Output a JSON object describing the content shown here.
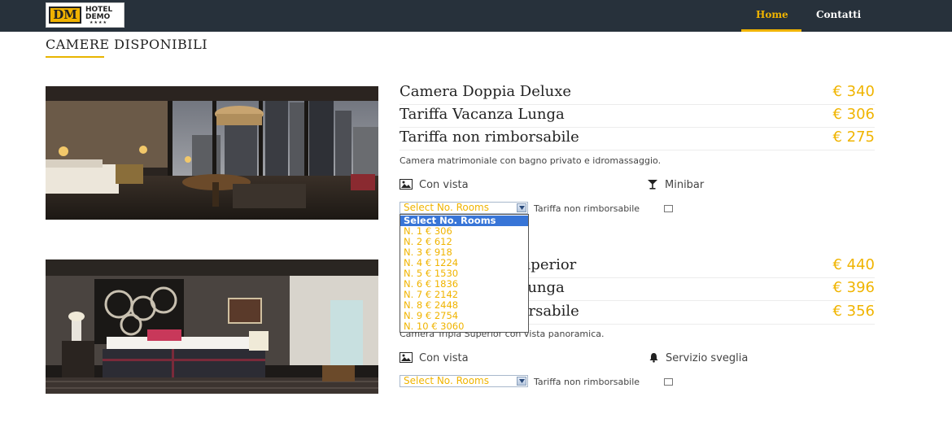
{
  "header": {
    "logo_mark": "DM",
    "logo_line1": "HOTEL",
    "logo_line2": "DEMO",
    "logo_stars": "★★★★",
    "nav": [
      {
        "label": "Home",
        "active": true
      },
      {
        "label": "Contatti",
        "active": false
      }
    ]
  },
  "section": {
    "title": "CAMERE DISPONIBILI"
  },
  "rooms": [
    {
      "rates": [
        {
          "name": "Camera Doppia Deluxe",
          "price": "€ 340"
        },
        {
          "name": "Tariffa Vacanza Lunga",
          "price": "€ 306"
        },
        {
          "name": "Tariffa non rimborsabile",
          "price": "€ 275"
        }
      ],
      "description": "Camera matrimoniale con bagno privato e idromassaggio.",
      "features": [
        {
          "icon": "picture-icon",
          "label": "Con vista"
        },
        {
          "icon": "cocktail-icon",
          "label": "Minibar"
        }
      ],
      "select_value": "Select No. Rooms",
      "refund_label": "Tariffa non rimborsabile"
    },
    {
      "rates": [
        {
          "name": "Camera Tripla Superior",
          "price": "€ 440"
        },
        {
          "name": "Tariffa Vacanza Lunga",
          "price": "€ 396"
        },
        {
          "name": "Tariffa non rimborsabile",
          "price": "€ 356"
        }
      ],
      "description": "Camera Tripla Superior con vista panoramica.",
      "features": [
        {
          "icon": "picture-icon",
          "label": "Con vista"
        },
        {
          "icon": "bell-icon",
          "label": "Servizio sveglia"
        }
      ],
      "select_value": "Select No. Rooms",
      "refund_label": "Tariffa non rimborsabile"
    }
  ],
  "dropdown": {
    "options": [
      "Select No. Rooms",
      "N. 1 € 306",
      "N. 2 € 612",
      "N. 3 € 918",
      "N. 4 € 1224",
      "N. 5 € 1530",
      "N. 6 € 1836",
      "N. 7 € 2142",
      "N. 8 € 2448",
      "N. 9 € 2754",
      "N. 10 € 3060"
    ],
    "selected_index": 0
  },
  "colors": {
    "accent": "#f0b400",
    "navbar": "#27313b",
    "highlight": "#3875d7"
  }
}
